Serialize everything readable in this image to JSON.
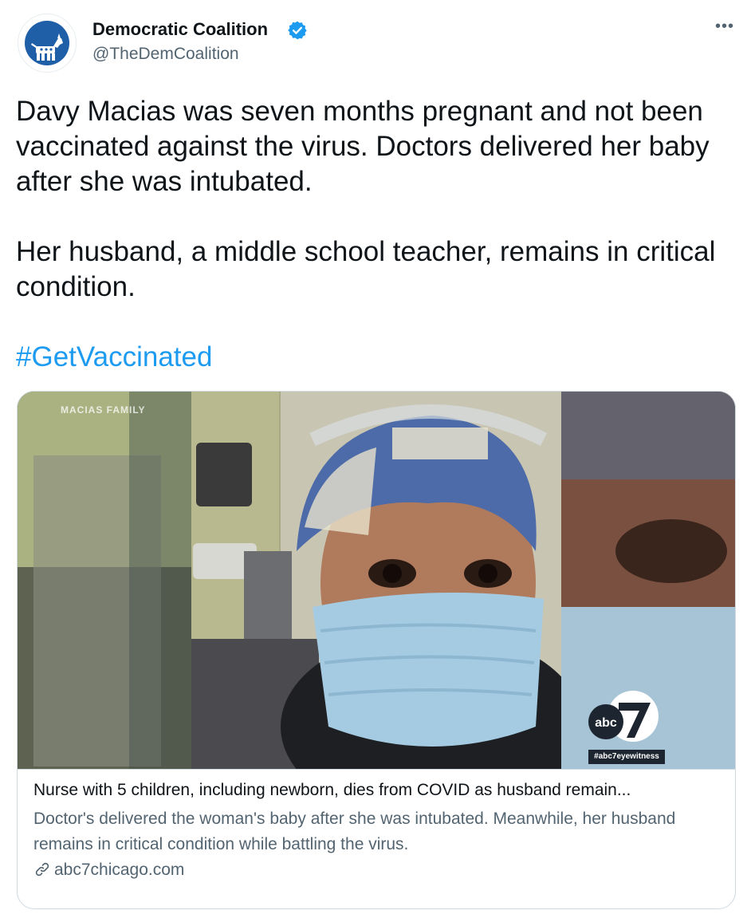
{
  "tweet": {
    "author": {
      "display_name": "Democratic Coalition",
      "handle": "@TheDemCoalition",
      "verified": true,
      "avatar_icon": "donkey-icon"
    },
    "more_label": "•••",
    "text": {
      "paragraph1": "Davy Macias was seven months pregnant and not been vaccinated against the virus. Doctors delivered her baby after she was intubated.",
      "paragraph2": "Her husband, a middle school teacher, remains in critical condition.",
      "hashtag": "#GetVaccinated"
    },
    "card": {
      "image_caption": "MACIAS FAMILY",
      "watermark_logo": "abc7-logo",
      "watermark_tag": "#abc7eyewitness",
      "title": "Nurse with 5 children, including newborn, dies from COVID as husband remain...",
      "description": "Doctor's delivered the woman's baby after she was intubated. Meanwhile, her husband remains in critical condition while battling the virus.",
      "domain": "abc7chicago.com",
      "domain_icon": "link-icon"
    }
  },
  "colors": {
    "text": "#0f1419",
    "secondary": "#536471",
    "accent": "#1d9bf0",
    "border": "#cfd9de"
  }
}
